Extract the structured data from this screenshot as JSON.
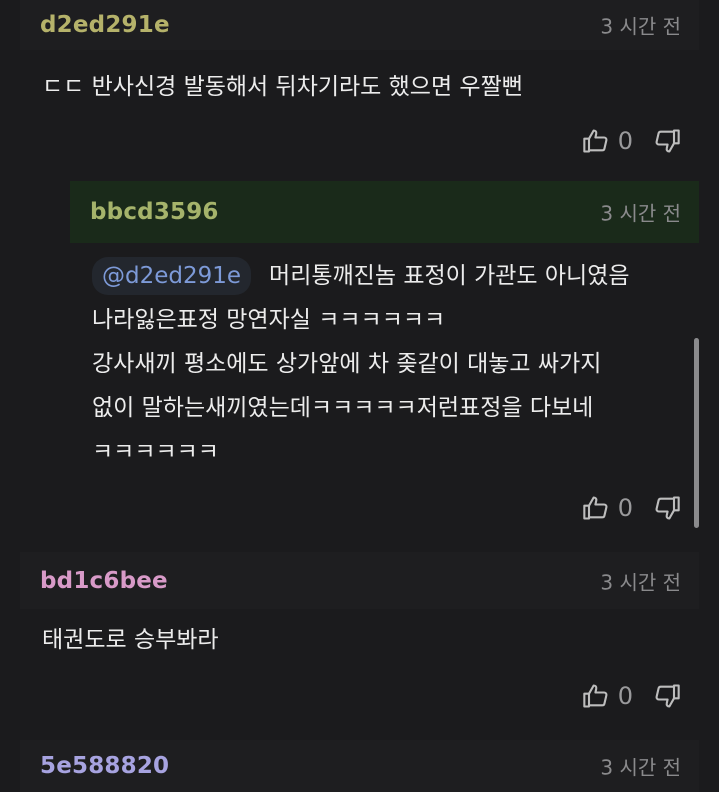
{
  "comments": [
    {
      "nickname": "d2ed291e",
      "time": "3 시간 전",
      "text": "ㄷㄷ 반사신경 발동해서 뒤차기라도 했으면 우짤뻔",
      "likes": "0",
      "nick_color": "#b5b26a"
    },
    {
      "nickname": "bbcd3596",
      "time": "3 시간 전",
      "mention": "@d2ed291e",
      "lines": [
        "머리통깨진놈 표정이 가관도 아니였음",
        "나라잃은표정 망연자실 ㅋㅋㅋㅋㅋㅋ",
        "강사새끼 평소에도 상가앞에 차 좆같이 대놓고 싸가지",
        "없이 말하는새끼였는데ㅋㅋㅋㅋㅋ저런표정을 다보네",
        "ㅋㅋㅋㅋㅋㅋ"
      ],
      "likes": "0",
      "nick_color": "#a5b36b",
      "header_bg": "#1a2a1a"
    },
    {
      "nickname": "bd1c6bee",
      "time": "3 시간 전",
      "text": "태권도로 승부봐라",
      "likes": "0",
      "nick_color": "#d89ac8"
    },
    {
      "nickname": "5e588820",
      "time": "3 시간 전",
      "nick_color": "#a7a3e0"
    }
  ],
  "icons": {
    "like": "thumbs-up-icon",
    "dislike": "thumbs-down-icon"
  }
}
